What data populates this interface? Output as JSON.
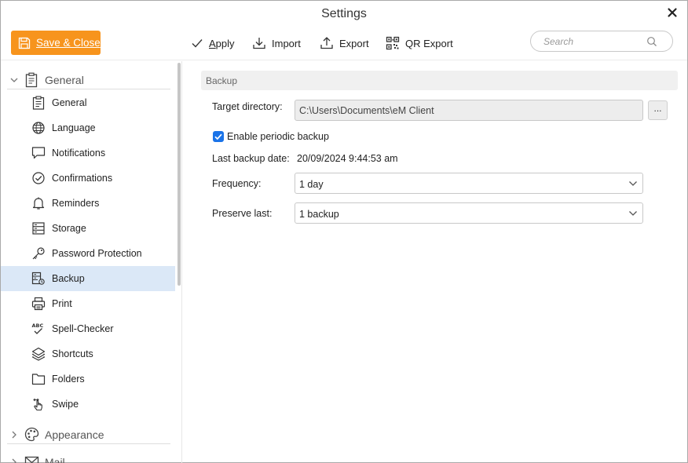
{
  "window": {
    "title": "Settings"
  },
  "toolbar": {
    "save_close": {
      "first_letter": "S",
      "rest": "ave & Close"
    },
    "apply": {
      "first_letter": "A",
      "rest": "pply"
    },
    "import": "Import",
    "export": "Export",
    "qr_export": "QR Export"
  },
  "search": {
    "placeholder": "Search"
  },
  "sidebar": {
    "groups": [
      {
        "label": "General",
        "expanded": true,
        "icon": "clipboard-icon"
      },
      {
        "label": "Appearance",
        "expanded": false,
        "icon": "palette-icon"
      },
      {
        "label": "Mail",
        "expanded": false,
        "icon": "envelope-icon"
      }
    ],
    "items": [
      {
        "label": "General",
        "icon": "clipboard-icon"
      },
      {
        "label": "Language",
        "icon": "globe-icon"
      },
      {
        "label": "Notifications",
        "icon": "speech-bubble-icon"
      },
      {
        "label": "Confirmations",
        "icon": "check-circle-icon"
      },
      {
        "label": "Reminders",
        "icon": "bell-icon"
      },
      {
        "label": "Storage",
        "icon": "storage-icon"
      },
      {
        "label": "Password Protection",
        "icon": "key-icon"
      },
      {
        "label": "Backup",
        "icon": "backup-icon",
        "active": true
      },
      {
        "label": "Print",
        "icon": "printer-icon"
      },
      {
        "label": "Spell-Checker",
        "icon": "spell-check-icon"
      },
      {
        "label": "Shortcuts",
        "icon": "layers-icon"
      },
      {
        "label": "Folders",
        "icon": "folder-icon"
      },
      {
        "label": "Swipe",
        "icon": "swipe-hand-icon"
      }
    ]
  },
  "backup": {
    "section_title": "Backup",
    "target_directory_label": "Target directory:",
    "target_directory_value": "C:\\Users\\Documents\\eM Client",
    "browse_label": "...",
    "enable_periodic": {
      "label": "Enable periodic backup",
      "checked": true
    },
    "last_backup_label": "Last backup date:",
    "last_backup_value": "20/09/2024 9:44:53 am",
    "frequency_label": "Frequency:",
    "frequency_value": "1 day",
    "preserve_label": "Preserve last:",
    "preserve_value": "1 backup"
  },
  "colors": {
    "accent_orange": "#f7941d",
    "selection": "#dbe8f7",
    "checkbox": "#1a73e8"
  }
}
